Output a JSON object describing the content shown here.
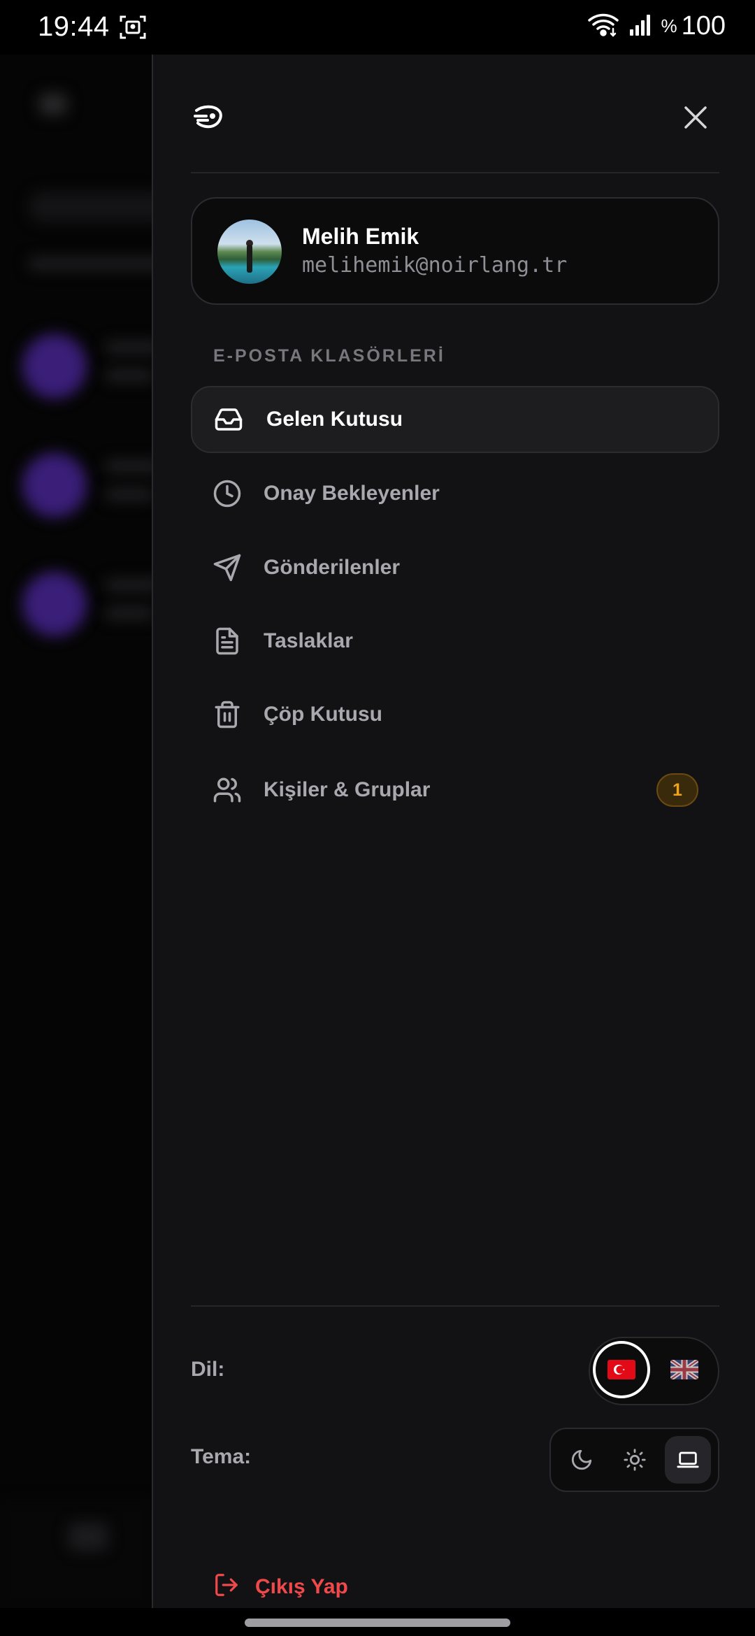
{
  "status_bar": {
    "time": "19:44",
    "battery_symbol": "%",
    "battery_value": "100",
    "icons": [
      "screenshot-icon",
      "wifi-icon",
      "signal-icon"
    ]
  },
  "drawer": {
    "logo_icon": "noirlang-logo-icon",
    "close_icon": "close-icon",
    "profile": {
      "name": "Melih Emik",
      "email": "melihemik@noirlang.tr"
    },
    "section_label": "E-POSTA KLASÖRLERİ",
    "folders": [
      {
        "label": "Gelen Kutusu",
        "icon": "inbox-icon",
        "active": true
      },
      {
        "label": "Onay Bekleyenler",
        "icon": "clock-icon",
        "active": false
      },
      {
        "label": "Gönderilenler",
        "icon": "send-icon",
        "active": false
      },
      {
        "label": "Taslaklar",
        "icon": "file-icon",
        "active": false
      },
      {
        "label": "Çöp Kutusu",
        "icon": "trash-icon",
        "active": false
      },
      {
        "label": "Kişiler & Gruplar",
        "icon": "users-icon",
        "active": false,
        "badge": "1"
      }
    ],
    "language": {
      "label": "Dil:",
      "options": [
        {
          "code": "tr",
          "icon": "turkey-flag-icon",
          "selected": true
        },
        {
          "code": "en",
          "icon": "uk-flag-icon",
          "selected": false
        }
      ]
    },
    "theme": {
      "label": "Tema:",
      "options": [
        {
          "name": "dark",
          "icon": "moon-icon",
          "selected": false
        },
        {
          "name": "light",
          "icon": "sun-icon",
          "selected": false
        },
        {
          "name": "system",
          "icon": "laptop-icon",
          "selected": true
        }
      ]
    },
    "logout_label": "Çıkış Yap"
  },
  "colors": {
    "drawer_bg": "#121214",
    "accent_badge": "#f0a31c",
    "logout_red": "#f0494b",
    "muted_text": "#a8a8ae"
  }
}
